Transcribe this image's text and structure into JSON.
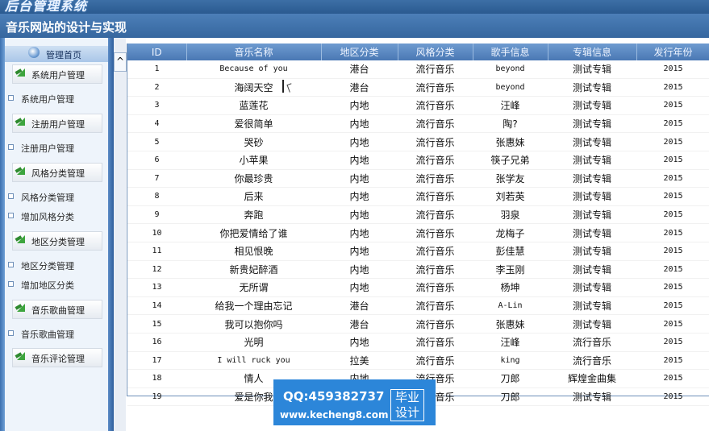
{
  "header": {
    "logo_text": "后台管理系统",
    "site_title": "音乐网站的设计与实现"
  },
  "sidebar": {
    "home": "管理首页",
    "groups": [
      {
        "title": "系统用户管理",
        "items": [
          "系统用户管理"
        ]
      },
      {
        "title": "注册用户管理",
        "items": [
          "注册用户管理"
        ]
      },
      {
        "title": "风格分类管理",
        "items": [
          "风格分类管理",
          "增加风格分类"
        ]
      },
      {
        "title": "地区分类管理",
        "items": [
          "地区分类管理",
          "增加地区分类"
        ]
      },
      {
        "title": "音乐歌曲管理",
        "items": [
          "音乐歌曲管理"
        ]
      },
      {
        "title": "音乐评论管理",
        "items": []
      }
    ]
  },
  "collapse_button": "^",
  "table": {
    "columns": [
      "ID",
      "音乐名称",
      "地区分类",
      "风格分类",
      "歌手信息",
      "专辑信息",
      "发行年份"
    ],
    "rows": [
      [
        "1",
        "Because of you",
        "港台",
        "流行音乐",
        "beyond",
        "测试专辑",
        "2015"
      ],
      [
        "2",
        "海阔天空",
        "港台",
        "流行音乐",
        "beyond",
        "测试专辑",
        "2015"
      ],
      [
        "3",
        "蓝莲花",
        "内地",
        "流行音乐",
        "汪峰",
        "测试专辑",
        "2015"
      ],
      [
        "4",
        "爱很简单",
        "内地",
        "流行音乐",
        "陶?",
        "测试专辑",
        "2015"
      ],
      [
        "5",
        "哭砂",
        "内地",
        "流行音乐",
        "张惠妹",
        "测试专辑",
        "2015"
      ],
      [
        "6",
        "小苹果",
        "内地",
        "流行音乐",
        "筷子兄弟",
        "测试专辑",
        "2015"
      ],
      [
        "7",
        "你最珍贵",
        "内地",
        "流行音乐",
        "张学友",
        "测试专辑",
        "2015"
      ],
      [
        "8",
        "后来",
        "内地",
        "流行音乐",
        "刘若英",
        "测试专辑",
        "2015"
      ],
      [
        "9",
        "奔跑",
        "内地",
        "流行音乐",
        "羽泉",
        "测试专辑",
        "2015"
      ],
      [
        "10",
        "你把爱情给了谁",
        "内地",
        "流行音乐",
        "龙梅子",
        "测试专辑",
        "2015"
      ],
      [
        "11",
        "相见恨晚",
        "内地",
        "流行音乐",
        "彭佳慧",
        "测试专辑",
        "2015"
      ],
      [
        "12",
        "新贵妃醉酒",
        "内地",
        "流行音乐",
        "李玉刚",
        "测试专辑",
        "2015"
      ],
      [
        "13",
        "无所谓",
        "内地",
        "流行音乐",
        "杨坤",
        "测试专辑",
        "2015"
      ],
      [
        "14",
        "给我一个理由忘记",
        "港台",
        "流行音乐",
        "A-Lin",
        "测试专辑",
        "2015"
      ],
      [
        "15",
        "我可以抱你吗",
        "港台",
        "流行音乐",
        "张惠妹",
        "测试专辑",
        "2015"
      ],
      [
        "16",
        "光明",
        "内地",
        "流行音乐",
        "汪峰",
        "流行音乐",
        "2015"
      ],
      [
        "17",
        "I will ruck you",
        "拉美",
        "流行音乐",
        "king",
        "流行音乐",
        "2015"
      ],
      [
        "18",
        "情人",
        "内地",
        "流行音乐",
        "刀郎",
        "辉煌金曲集",
        "2015"
      ],
      [
        "19",
        "爱是你我",
        "内地",
        "流行音乐",
        "刀郎",
        "测试专辑",
        "2015"
      ]
    ]
  },
  "watermark": {
    "qq": "QQ:459382737",
    "url": "www.kecheng8.com",
    "tag_line1": "毕业",
    "tag_line2": "设计"
  }
}
